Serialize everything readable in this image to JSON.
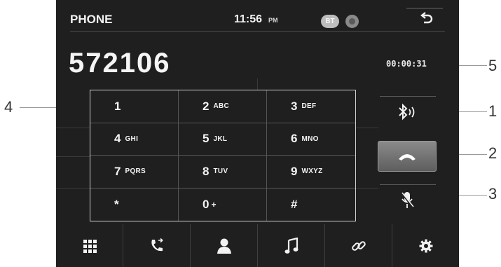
{
  "header": {
    "title": "PHONE",
    "time": "11:56",
    "ampm": "PM",
    "bt_label": "BT"
  },
  "call": {
    "number": "572106",
    "duration": "00:00:31"
  },
  "keypad": [
    {
      "digit": "1",
      "letters": ""
    },
    {
      "digit": "2",
      "letters": "ABC"
    },
    {
      "digit": "3",
      "letters": "DEF"
    },
    {
      "digit": "4",
      "letters": "GHI"
    },
    {
      "digit": "5",
      "letters": "JKL"
    },
    {
      "digit": "6",
      "letters": "MNO"
    },
    {
      "digit": "7",
      "letters": "PQRS"
    },
    {
      "digit": "8",
      "letters": "TUV"
    },
    {
      "digit": "9",
      "letters": "WXYZ"
    },
    {
      "digit": "*",
      "letters": ""
    },
    {
      "digit": "0",
      "letters": "+"
    },
    {
      "digit": "#",
      "letters": ""
    }
  ],
  "side_controls": [
    "bluetooth-audio-icon",
    "end-call-icon",
    "microphone-mute-icon"
  ],
  "bottom_nav": [
    "keypad-grid-icon",
    "call-log-icon",
    "contacts-icon",
    "music-icon",
    "link-icon",
    "settings-gear-icon"
  ],
  "callouts": {
    "c1": "1",
    "c2": "2",
    "c3": "3",
    "c4": "4",
    "c5": "5"
  },
  "colors": {
    "screen_bg": "#1f1f1f",
    "text": "#f4f4f4",
    "end_call_button": "#6e6e6e"
  }
}
